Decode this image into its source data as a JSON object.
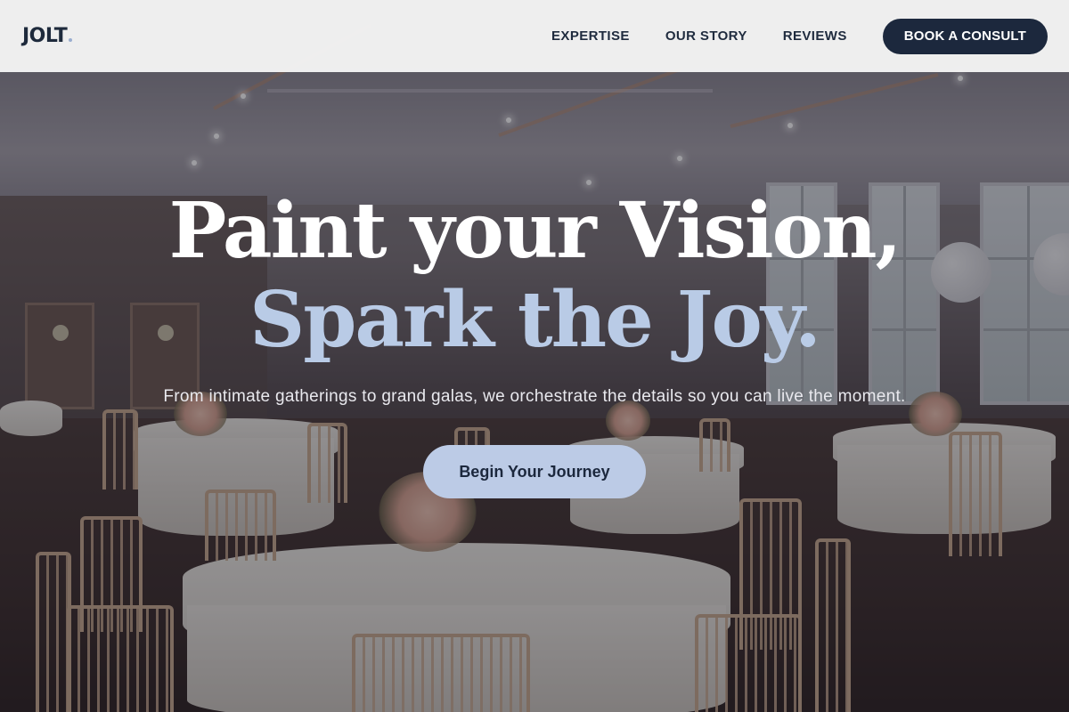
{
  "brand": {
    "logo_text": "JOLT",
    "accent_color": "#9aaed0"
  },
  "nav": {
    "links": [
      "EXPERTISE",
      "OUR STORY",
      "REVIEWS"
    ],
    "cta_label": "BOOK A CONSULT",
    "cta_color": "#1c283d"
  },
  "hero": {
    "headline_line1": "Paint your Vision,",
    "headline_line2": "Spark the Joy.",
    "headline_line2_color": "#b9cbe6",
    "subtitle": "From intimate gatherings to grand galas, we orchestrate the details so you can live the moment.",
    "button_label": "Begin Your Journey",
    "button_color": "#bccbe6",
    "background_image": "banquet-hall-photo"
  }
}
